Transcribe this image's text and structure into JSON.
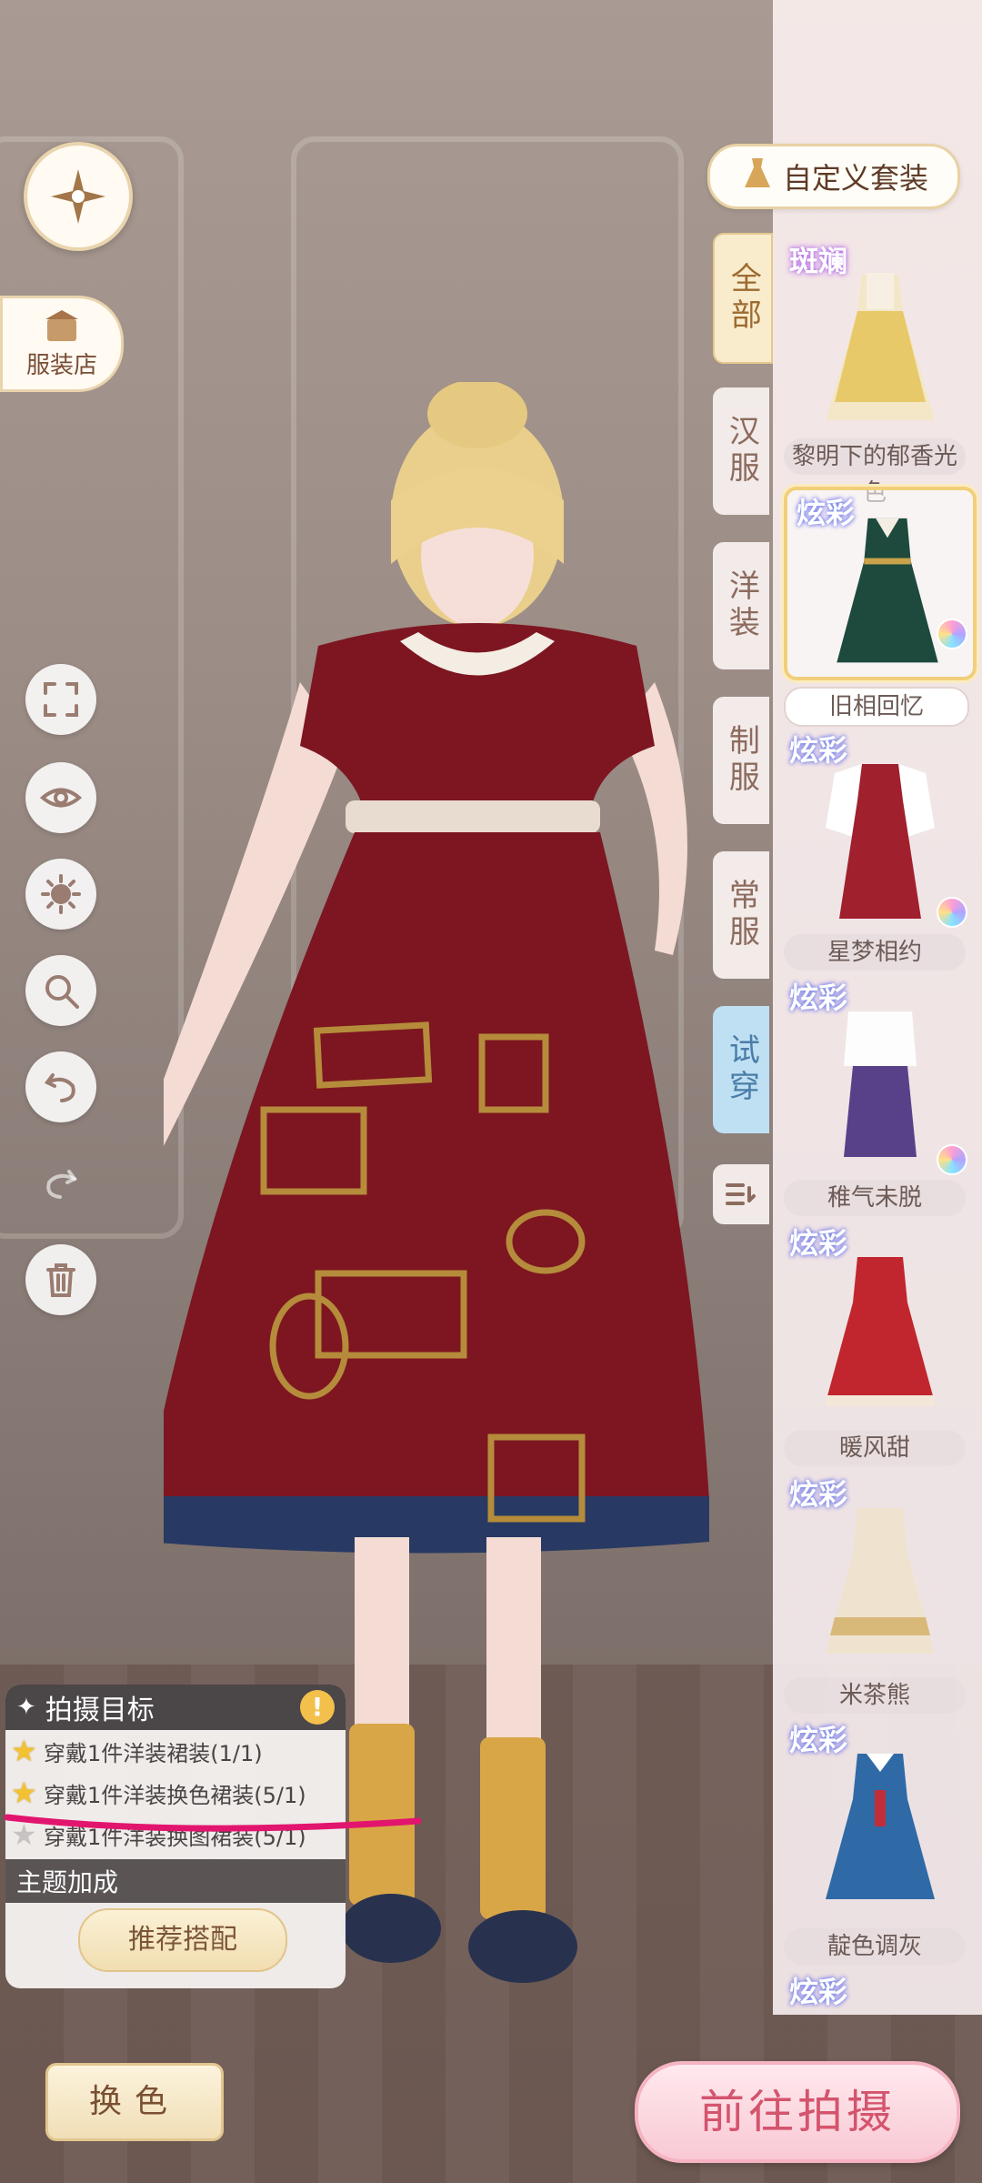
{
  "header": {
    "custom_suit_label": "自定义套装"
  },
  "left_toolbar": {
    "shop_label": "服装店"
  },
  "tabs": [
    {
      "label": "全部",
      "active": true
    },
    {
      "label": "汉服",
      "active": false
    },
    {
      "label": "洋装",
      "active": false
    },
    {
      "label": "制服",
      "active": false
    },
    {
      "label": "常服",
      "active": false
    },
    {
      "label": "试穿",
      "active": false
    }
  ],
  "outfits": [
    {
      "badge": "斑斓",
      "name": "黎明下的郁香光色"
    },
    {
      "badge": "炫彩",
      "name": "旧相回忆",
      "selected": true
    },
    {
      "badge": "炫彩",
      "name": "星梦相约"
    },
    {
      "badge": "炫彩",
      "name": "稚气未脱"
    },
    {
      "badge": "炫彩",
      "name": "暖风甜"
    },
    {
      "badge": "炫彩",
      "name": "米茶熊"
    },
    {
      "badge": "炫彩",
      "name": "靛色调灰"
    },
    {
      "badge": "炫彩",
      "name": ""
    }
  ],
  "mission": {
    "title": "拍摄目标",
    "tasks": [
      {
        "text": "穿戴1件洋装裙装(1/1)",
        "done": true
      },
      {
        "text": "穿戴1件洋装换色裙装(5/1)",
        "done": true
      },
      {
        "text": "穿戴1件洋装换图裙装(5/1)",
        "done": false
      }
    ],
    "bonus_label": "主题加成",
    "recommend_label": "推荐搭配"
  },
  "bottom": {
    "change_color_label": "换色",
    "go_shoot_label": "前往拍摄"
  },
  "colors": {
    "accent_pink": "#d4546d",
    "gold": "#e3c68f",
    "dress_red": "#7d1620"
  }
}
